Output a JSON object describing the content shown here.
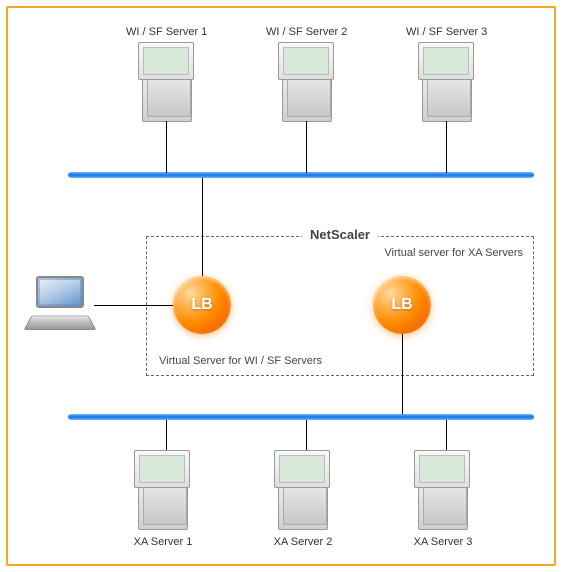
{
  "diagram": {
    "top_servers": [
      {
        "label": "WI / SF Server 1"
      },
      {
        "label": "WI / SF Server 2"
      },
      {
        "label": "WI / SF Server 3"
      }
    ],
    "bottom_servers": [
      {
        "label": "XA Server 1"
      },
      {
        "label": "XA Server 2"
      },
      {
        "label": "XA Server 3"
      }
    ],
    "netscaler": {
      "title": "NetScaler",
      "xa_vserver_label": "Virtual server for XA Servers",
      "wi_vserver_label": "Virtual Server for WI / SF Servers",
      "lb1_label": "LB",
      "lb2_label": "LB"
    }
  }
}
